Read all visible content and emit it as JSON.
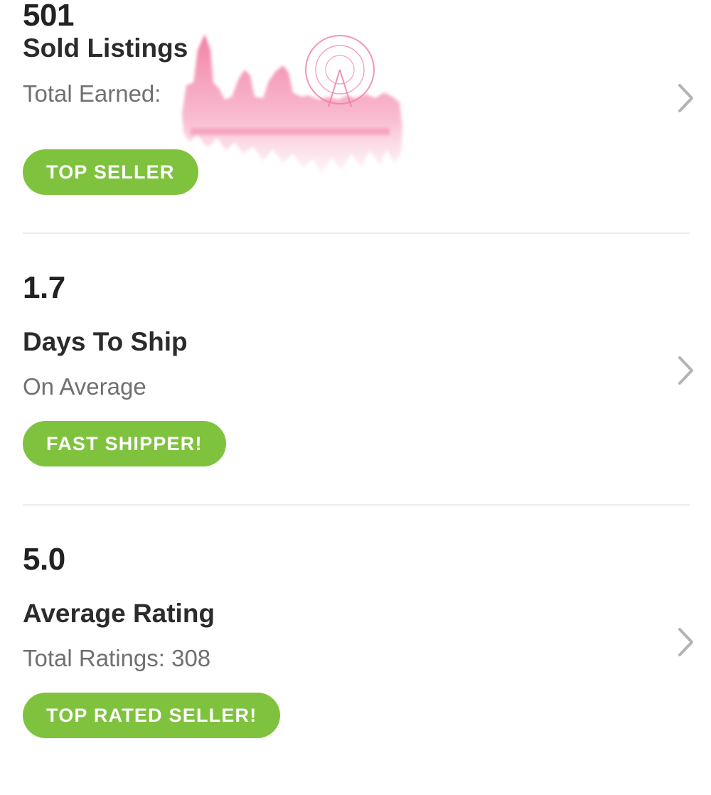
{
  "stats": [
    {
      "value": "501",
      "title": "Sold Listings",
      "subtitle": "Total Earned:",
      "badge": "TOP SELLER",
      "chevron_icon": "chevron-right-icon"
    },
    {
      "value": "1.7",
      "title": "Days To Ship",
      "subtitle": "On Average",
      "badge": "FAST SHIPPER!",
      "chevron_icon": "chevron-right-icon"
    },
    {
      "value": "5.0",
      "title": "Average Rating",
      "subtitle": "Total Ratings: 308",
      "badge": "TOP RATED SELLER!",
      "chevron_icon": "chevron-right-icon"
    }
  ],
  "watermark": {
    "icon": "city-skyline-watercolor-icon"
  },
  "colors": {
    "badge_green": "#7fc23e",
    "value_text": "#222222",
    "subtitle_text": "#707070",
    "divider": "#ececec",
    "chevron": "#b4b4b4",
    "watermark_pink": "#ee5b8c"
  }
}
